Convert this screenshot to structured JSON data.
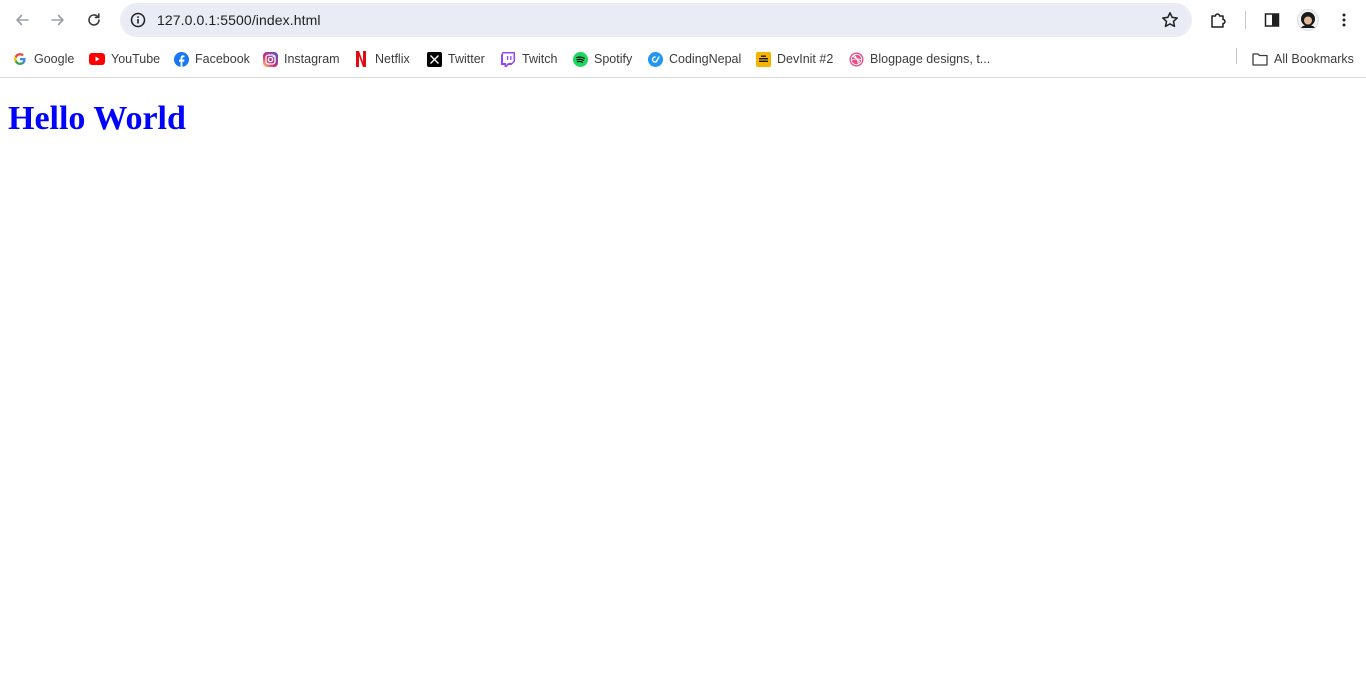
{
  "browser": {
    "url": "127.0.0.1:5500/index.html"
  },
  "bookmarks": [
    {
      "label": "Google",
      "icon": "google-icon"
    },
    {
      "label": "YouTube",
      "icon": "youtube-icon"
    },
    {
      "label": "Facebook",
      "icon": "facebook-icon"
    },
    {
      "label": "Instagram",
      "icon": "instagram-icon"
    },
    {
      "label": "Netflix",
      "icon": "netflix-icon"
    },
    {
      "label": "Twitter",
      "icon": "twitter-x-icon"
    },
    {
      "label": "Twitch",
      "icon": "twitch-icon"
    },
    {
      "label": "Spotify",
      "icon": "spotify-icon"
    },
    {
      "label": "CodingNepal",
      "icon": "codingnepal-icon"
    },
    {
      "label": "DevInit #2",
      "icon": "devinit-icon"
    },
    {
      "label": "Blogpage designs, t...",
      "icon": "dribbble-icon"
    }
  ],
  "all_bookmarks_label": "All Bookmarks",
  "page": {
    "heading": "Hello World",
    "heading_color": "#0000ff"
  }
}
